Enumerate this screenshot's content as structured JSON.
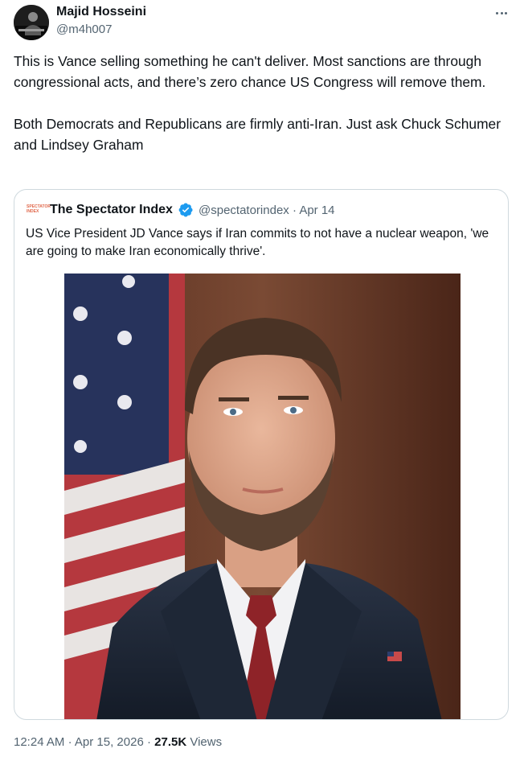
{
  "author": {
    "name": "Majid Hosseini",
    "handle": "@m4h007"
  },
  "tweet": {
    "text": "This is Vance selling something he can't deliver. Most sanctions are through congressional acts, and there’s zero chance US Congress will remove them.\n\nBoth Democrats and Republicans are firmly anti-Iran. Just ask Chuck Schumer and Lindsey Graham"
  },
  "quote": {
    "logo_text": "SPECTATOR INDEX",
    "name": "The Spectator Index",
    "handle": "@spectatorindex",
    "separator": "·",
    "date": "Apr 14",
    "text": "US Vice President JD Vance says if Iran commits to not have a nuclear weapon, 'we are going to make Iran economically thrive'."
  },
  "footer": {
    "time": "12:24 AM",
    "separator": "·",
    "date": "Apr 15, 2026",
    "views_count": "27.5K",
    "views_label": "Views"
  },
  "colors": {
    "text_primary": "#0f1419",
    "text_secondary": "#536471",
    "border": "#cfd9de",
    "verified_blue": "#1d9bf0"
  },
  "icons": {
    "more": "more-horizontal-icon",
    "verified": "verified-badge-icon"
  }
}
